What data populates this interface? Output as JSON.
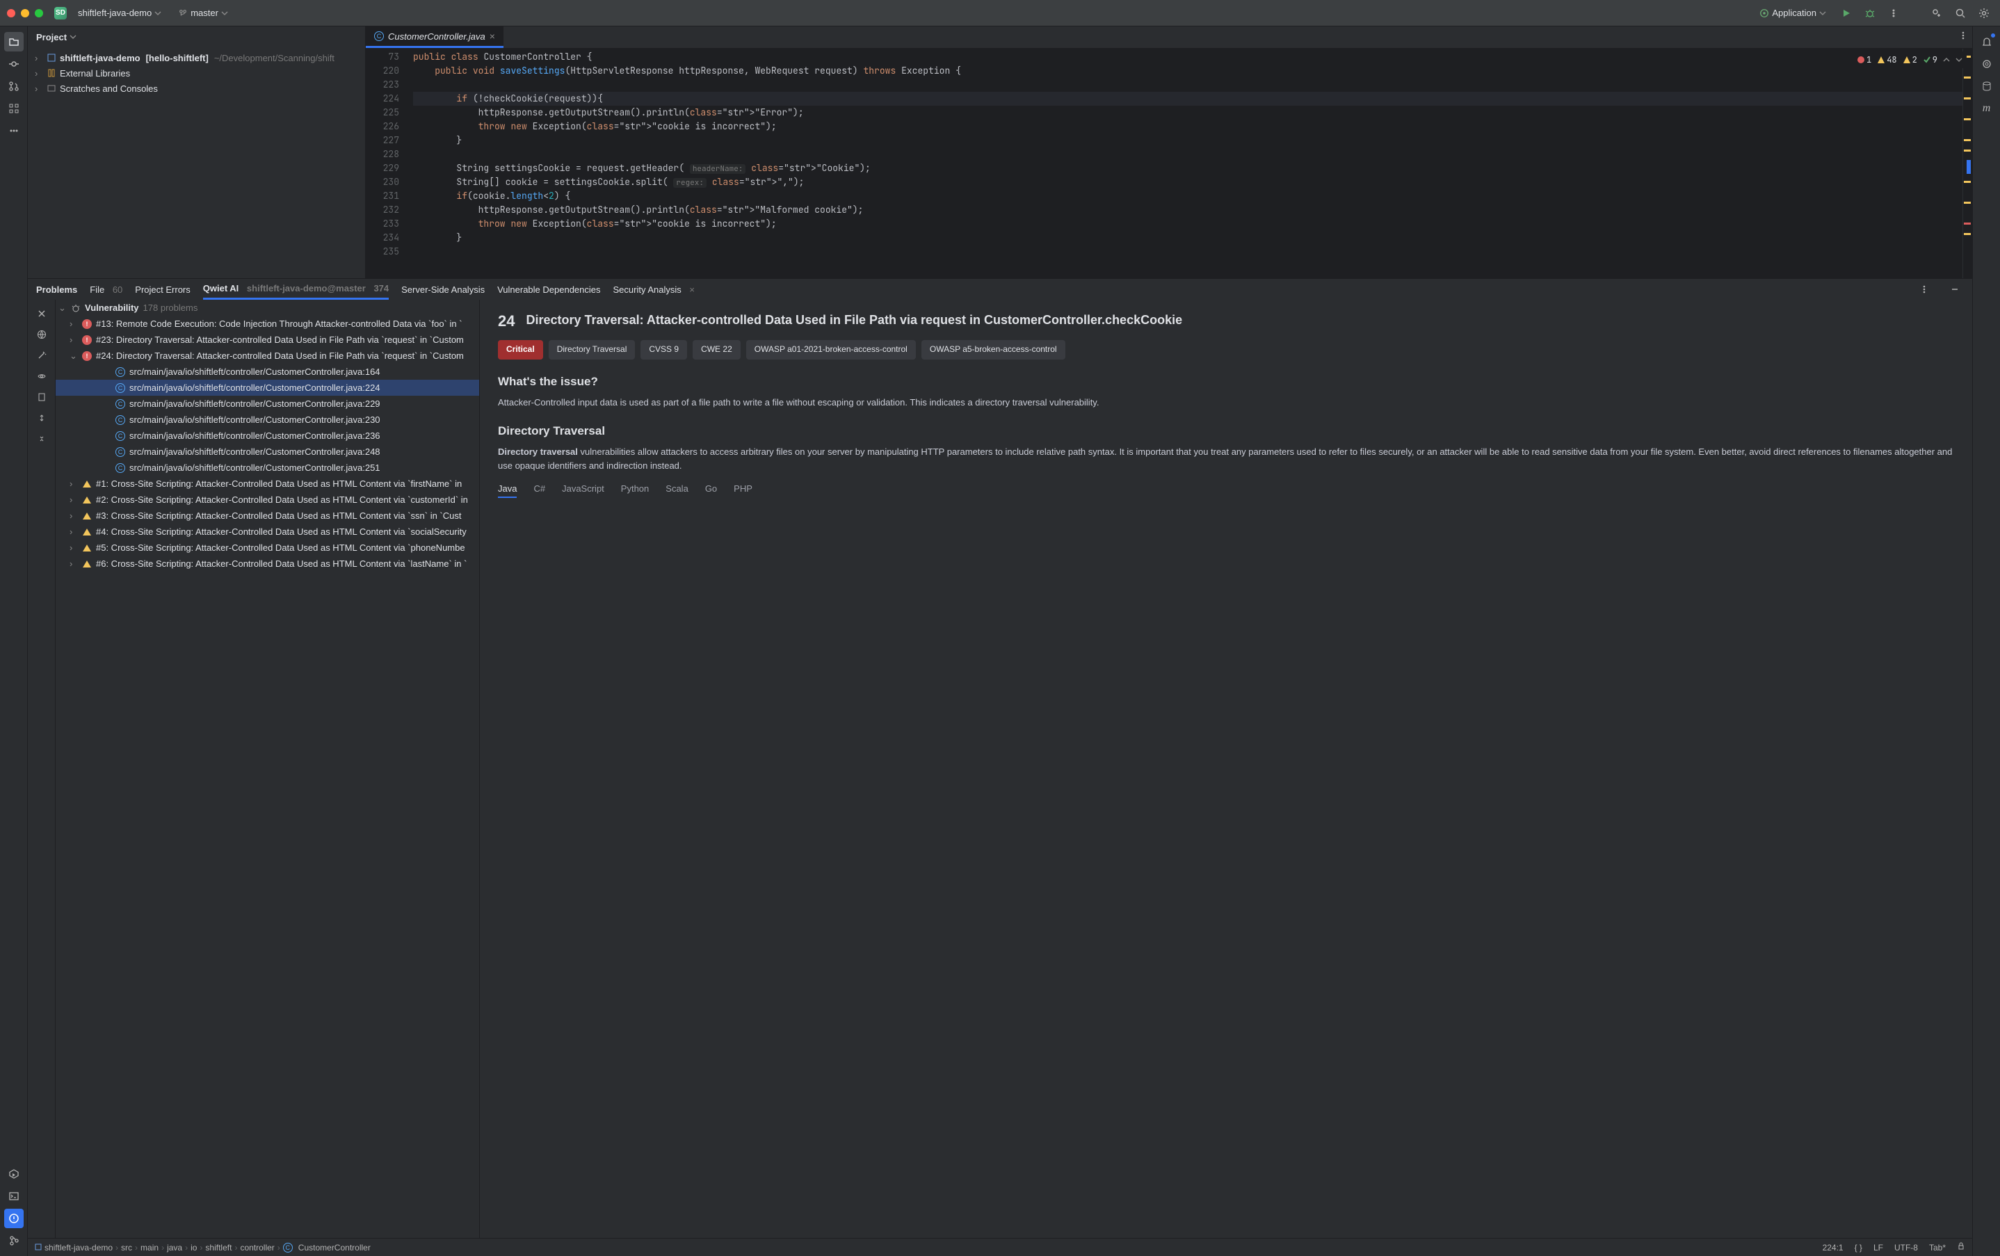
{
  "titlebar": {
    "project_badge": "SD",
    "project_name": "shiftleft-java-demo",
    "branch": "master",
    "run_config": "Application"
  },
  "project_panel": {
    "title": "Project",
    "root_name": "shiftleft-java-demo",
    "root_hint": "[hello-shiftleft]",
    "root_path": "~/Development/Scanning/shift",
    "external_libs": "External Libraries",
    "scratches": "Scratches and Consoles"
  },
  "editor": {
    "tab_name": "CustomerController.java",
    "inspections": {
      "errors": "1",
      "warnings": "48",
      "typos": "2",
      "ok": "9"
    },
    "lines": [
      {
        "n": "73",
        "t": "public class CustomerController {"
      },
      {
        "n": "220",
        "t": "    public void saveSettings(HttpServletResponse httpResponse, WebRequest request) throws Exception {"
      },
      {
        "n": "223",
        "t": ""
      },
      {
        "n": "224",
        "t": "        if (!checkCookie(request)){",
        "hl": true
      },
      {
        "n": "225",
        "t": "            httpResponse.getOutputStream().println(\"Error\");"
      },
      {
        "n": "226",
        "t": "            throw new Exception(\"cookie is incorrect\");"
      },
      {
        "n": "227",
        "t": "        }"
      },
      {
        "n": "228",
        "t": ""
      },
      {
        "n": "229",
        "t": "        String settingsCookie = request.getHeader( headerName: \"Cookie\");"
      },
      {
        "n": "230",
        "t": "        String[] cookie = settingsCookie.split( regex: \",\");"
      },
      {
        "n": "231",
        "t": "        if(cookie.length<2) {"
      },
      {
        "n": "232",
        "t": "            httpResponse.getOutputStream().println(\"Malformed cookie\");"
      },
      {
        "n": "233",
        "t": "            throw new Exception(\"cookie is incorrect\");"
      },
      {
        "n": "234",
        "t": "        }"
      },
      {
        "n": "235",
        "t": ""
      }
    ]
  },
  "tool_tabs": {
    "problems": "Problems",
    "file": "File",
    "file_count": "60",
    "project_errors": "Project Errors",
    "qwiet": "Qwiet AI",
    "qwiet_ctx": "shiftleft-java-demo@master",
    "qwiet_count": "374",
    "server_side": "Server-Side Analysis",
    "vuln_deps": "Vulnerable Dependencies",
    "sec_analysis": "Security Analysis"
  },
  "issues": {
    "category": "Vulnerability",
    "category_count": "178 problems",
    "items": [
      {
        "sev": "crit",
        "chev": "›",
        "label": "#13: Remote Code Execution: Code Injection Through Attacker-controlled Data via `foo` in `"
      },
      {
        "sev": "crit",
        "chev": "›",
        "label": "#23: Directory Traversal: Attacker-controlled Data Used in File Path via `request` in `Custom"
      },
      {
        "sev": "crit",
        "chev": "⌄",
        "label": "#24: Directory Traversal: Attacker-controlled Data Used in File Path via `request` in `Custom"
      },
      {
        "sev": "file",
        "chev": "",
        "indent": 2,
        "label": "src/main/java/io/shiftleft/controller/CustomerController.java:164"
      },
      {
        "sev": "file",
        "chev": "",
        "indent": 2,
        "sel": true,
        "label": "src/main/java/io/shiftleft/controller/CustomerController.java:224"
      },
      {
        "sev": "file",
        "chev": "",
        "indent": 2,
        "label": "src/main/java/io/shiftleft/controller/CustomerController.java:229"
      },
      {
        "sev": "file",
        "chev": "",
        "indent": 2,
        "label": "src/main/java/io/shiftleft/controller/CustomerController.java:230"
      },
      {
        "sev": "file",
        "chev": "",
        "indent": 2,
        "label": "src/main/java/io/shiftleft/controller/CustomerController.java:236"
      },
      {
        "sev": "file",
        "chev": "",
        "indent": 2,
        "label": "src/main/java/io/shiftleft/controller/CustomerController.java:248"
      },
      {
        "sev": "file",
        "chev": "",
        "indent": 2,
        "label": "src/main/java/io/shiftleft/controller/CustomerController.java:251"
      },
      {
        "sev": "warn",
        "chev": "›",
        "label": "#1: Cross-Site Scripting: Attacker-Controlled Data Used as HTML Content via `firstName` in"
      },
      {
        "sev": "warn",
        "chev": "›",
        "label": "#2: Cross-Site Scripting: Attacker-Controlled Data Used as HTML Content via `customerId` in"
      },
      {
        "sev": "warn",
        "chev": "›",
        "label": "#3: Cross-Site Scripting: Attacker-Controlled Data Used as HTML Content via `ssn` in `Cust"
      },
      {
        "sev": "warn",
        "chev": "›",
        "label": "#4: Cross-Site Scripting: Attacker-Controlled Data Used as HTML Content via `socialSecurity"
      },
      {
        "sev": "warn",
        "chev": "›",
        "label": "#5: Cross-Site Scripting: Attacker-Controlled Data Used as HTML Content via `phoneNumbe"
      },
      {
        "sev": "warn",
        "chev": "›",
        "label": "#6: Cross-Site Scripting: Attacker-Controlled Data Used as HTML Content via `lastName` in `"
      }
    ]
  },
  "detail": {
    "number": "24",
    "title": "Directory Traversal: Attacker-controlled Data Used in File Path via request in CustomerController.checkCookie",
    "badges": [
      "Critical",
      "Directory Traversal",
      "CVSS 9",
      "CWE 22",
      "OWASP a01-2021-broken-access-control",
      "OWASP a5-broken-access-control"
    ],
    "h_issue": "What's the issue?",
    "p_issue": "Attacker-Controlled input data is used as part of a file path to write a file without escaping or validation. This indicates a directory traversal vulnerability.",
    "h_dt": "Directory Traversal",
    "p_dt_strong": "Directory traversal",
    "p_dt": " vulnerabilities allow attackers to access arbitrary files on your server by manipulating HTTP parameters to include relative path syntax. It is important that you treat any parameters used to refer to files securely, or an attacker will be able to read sensitive data from your file system. Even better, avoid direct references to filenames altogether and use opaque identifiers and indirection instead.",
    "langs": [
      "Java",
      "C#",
      "JavaScript",
      "Python",
      "Scala",
      "Go",
      "PHP"
    ]
  },
  "statusbar": {
    "crumbs": [
      "shiftleft-java-demo",
      "src",
      "main",
      "java",
      "io",
      "shiftleft",
      "controller",
      "CustomerController"
    ],
    "pos": "224:1",
    "le": "LF",
    "enc": "UTF-8",
    "indent": "Tab*"
  }
}
